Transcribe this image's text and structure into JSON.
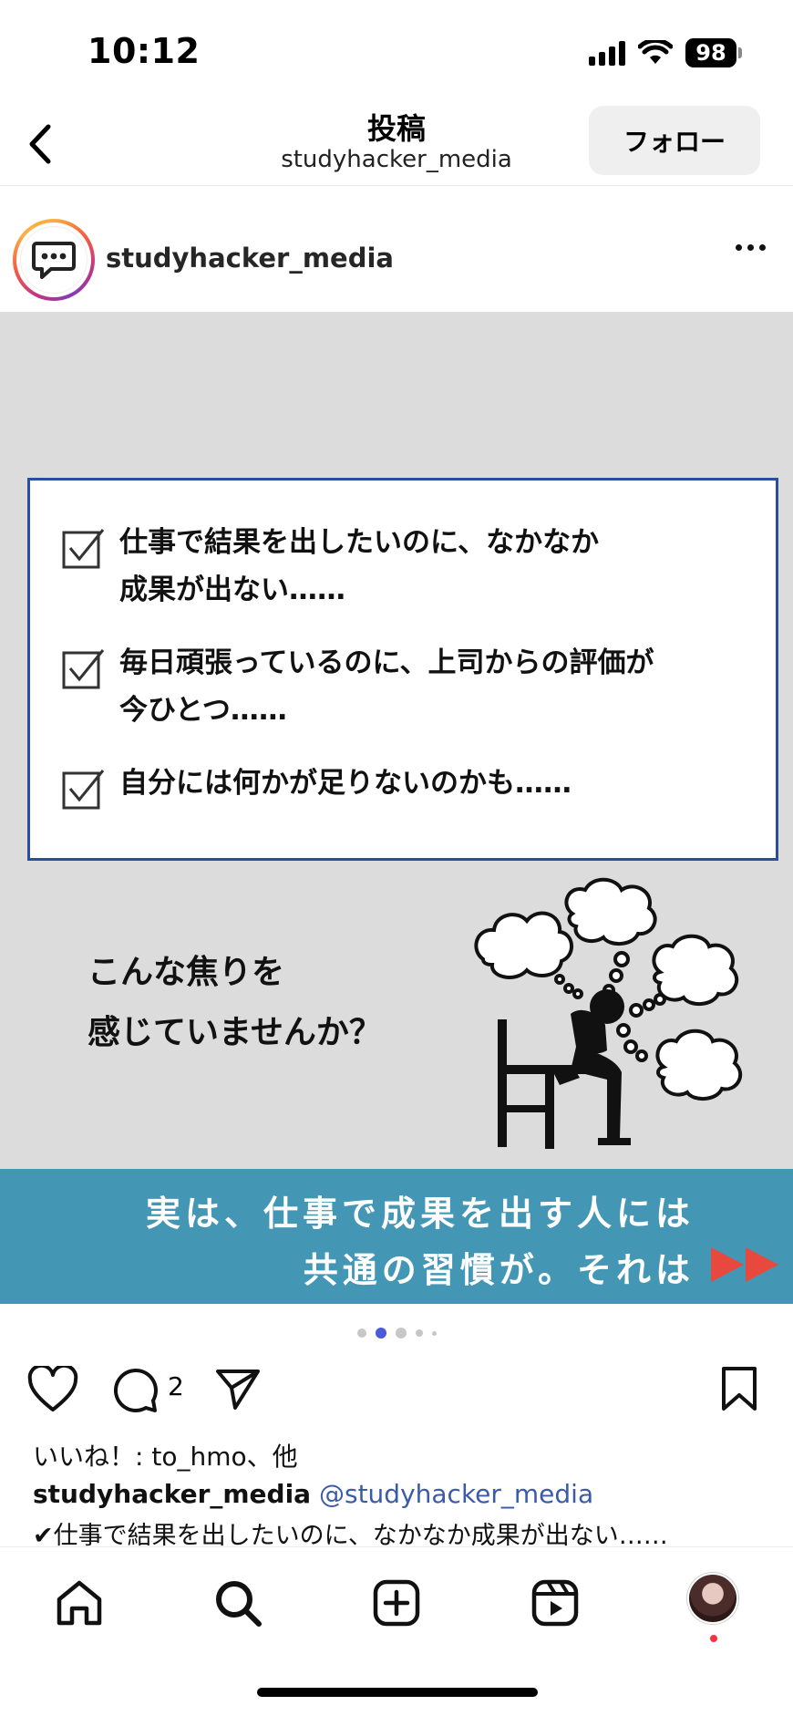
{
  "status": {
    "time": "10:12",
    "battery": "98"
  },
  "header": {
    "title": "投稿",
    "subtitle": "studyhacker_media",
    "follow_label": "フォロー"
  },
  "post": {
    "username": "studyhacker_media",
    "image": {
      "checklist": [
        {
          "line1": "仕事で結果を出したいのに、なかなか",
          "line2": "成果が出ない……"
        },
        {
          "line1": "毎日頑張っているのに、上司からの評価が",
          "line2": "今ひとつ……"
        },
        {
          "line1": "自分には何かが足りないのかも……",
          "line2": ""
        }
      ],
      "question_line1": "こんな焦りを",
      "question_line2": "感じていませんか？",
      "banner_line1": "実は、仕事で成果を出す人には",
      "banner_line2": "共通の習慣が。それは"
    },
    "carousel_active_index": 1,
    "comment_count": "2",
    "likes_text": "いいね！: to_hmo、他",
    "caption_user": "studyhacker_media",
    "caption_mention": "@studyhacker_media",
    "caption_text": "✔仕事で結果を出したいのに、なかなか成果が出ない……"
  },
  "colors": {
    "banner": "#4396b4",
    "checklist_border": "#2a4da0",
    "accent_dot": "#4a5ad8",
    "arrow": "#e8493f"
  },
  "icons": {
    "back": "chevron-left-icon",
    "more": "more-icon",
    "like": "heart-icon",
    "comment": "comment-icon",
    "share": "send-icon",
    "save": "bookmark-icon",
    "home": "home-icon",
    "search": "search-icon",
    "create": "plus-square-icon",
    "reels": "reels-icon"
  }
}
